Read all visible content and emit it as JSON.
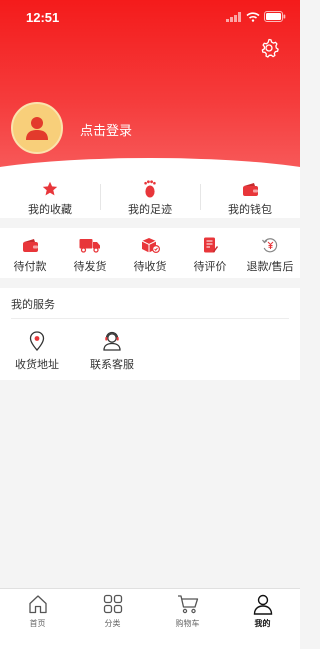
{
  "status_bar": {
    "time": "12:51"
  },
  "header": {
    "login_text": "点击登录"
  },
  "quick_links": [
    {
      "label": "我的收藏",
      "icon": "star-icon"
    },
    {
      "label": "我的足迹",
      "icon": "footprint-icon"
    },
    {
      "label": "我的钱包",
      "icon": "wallet-icon"
    }
  ],
  "orders": [
    {
      "label": "待付款",
      "icon": "wallet-icon"
    },
    {
      "label": "待发货",
      "icon": "truck-icon"
    },
    {
      "label": "待收货",
      "icon": "box-icon"
    },
    {
      "label": "待评价",
      "icon": "review-icon"
    },
    {
      "label": "退款/售后",
      "icon": "refund-icon"
    }
  ],
  "services": {
    "title": "我的服务",
    "items": [
      {
        "label": "收货地址",
        "icon": "location-pin-icon"
      },
      {
        "label": "联系客服",
        "icon": "customer-service-icon"
      }
    ]
  },
  "tabbar": [
    {
      "label": "首页",
      "icon": "home-icon"
    },
    {
      "label": "分类",
      "icon": "category-icon"
    },
    {
      "label": "购物车",
      "icon": "cart-icon"
    },
    {
      "label": "我的",
      "icon": "person-icon"
    }
  ],
  "colors": {
    "brand_red": "#f41b1b",
    "accent_red": "#e8363a",
    "avatar_bg": "#f8cf7a",
    "avatar_fg": "#e33a2c"
  }
}
